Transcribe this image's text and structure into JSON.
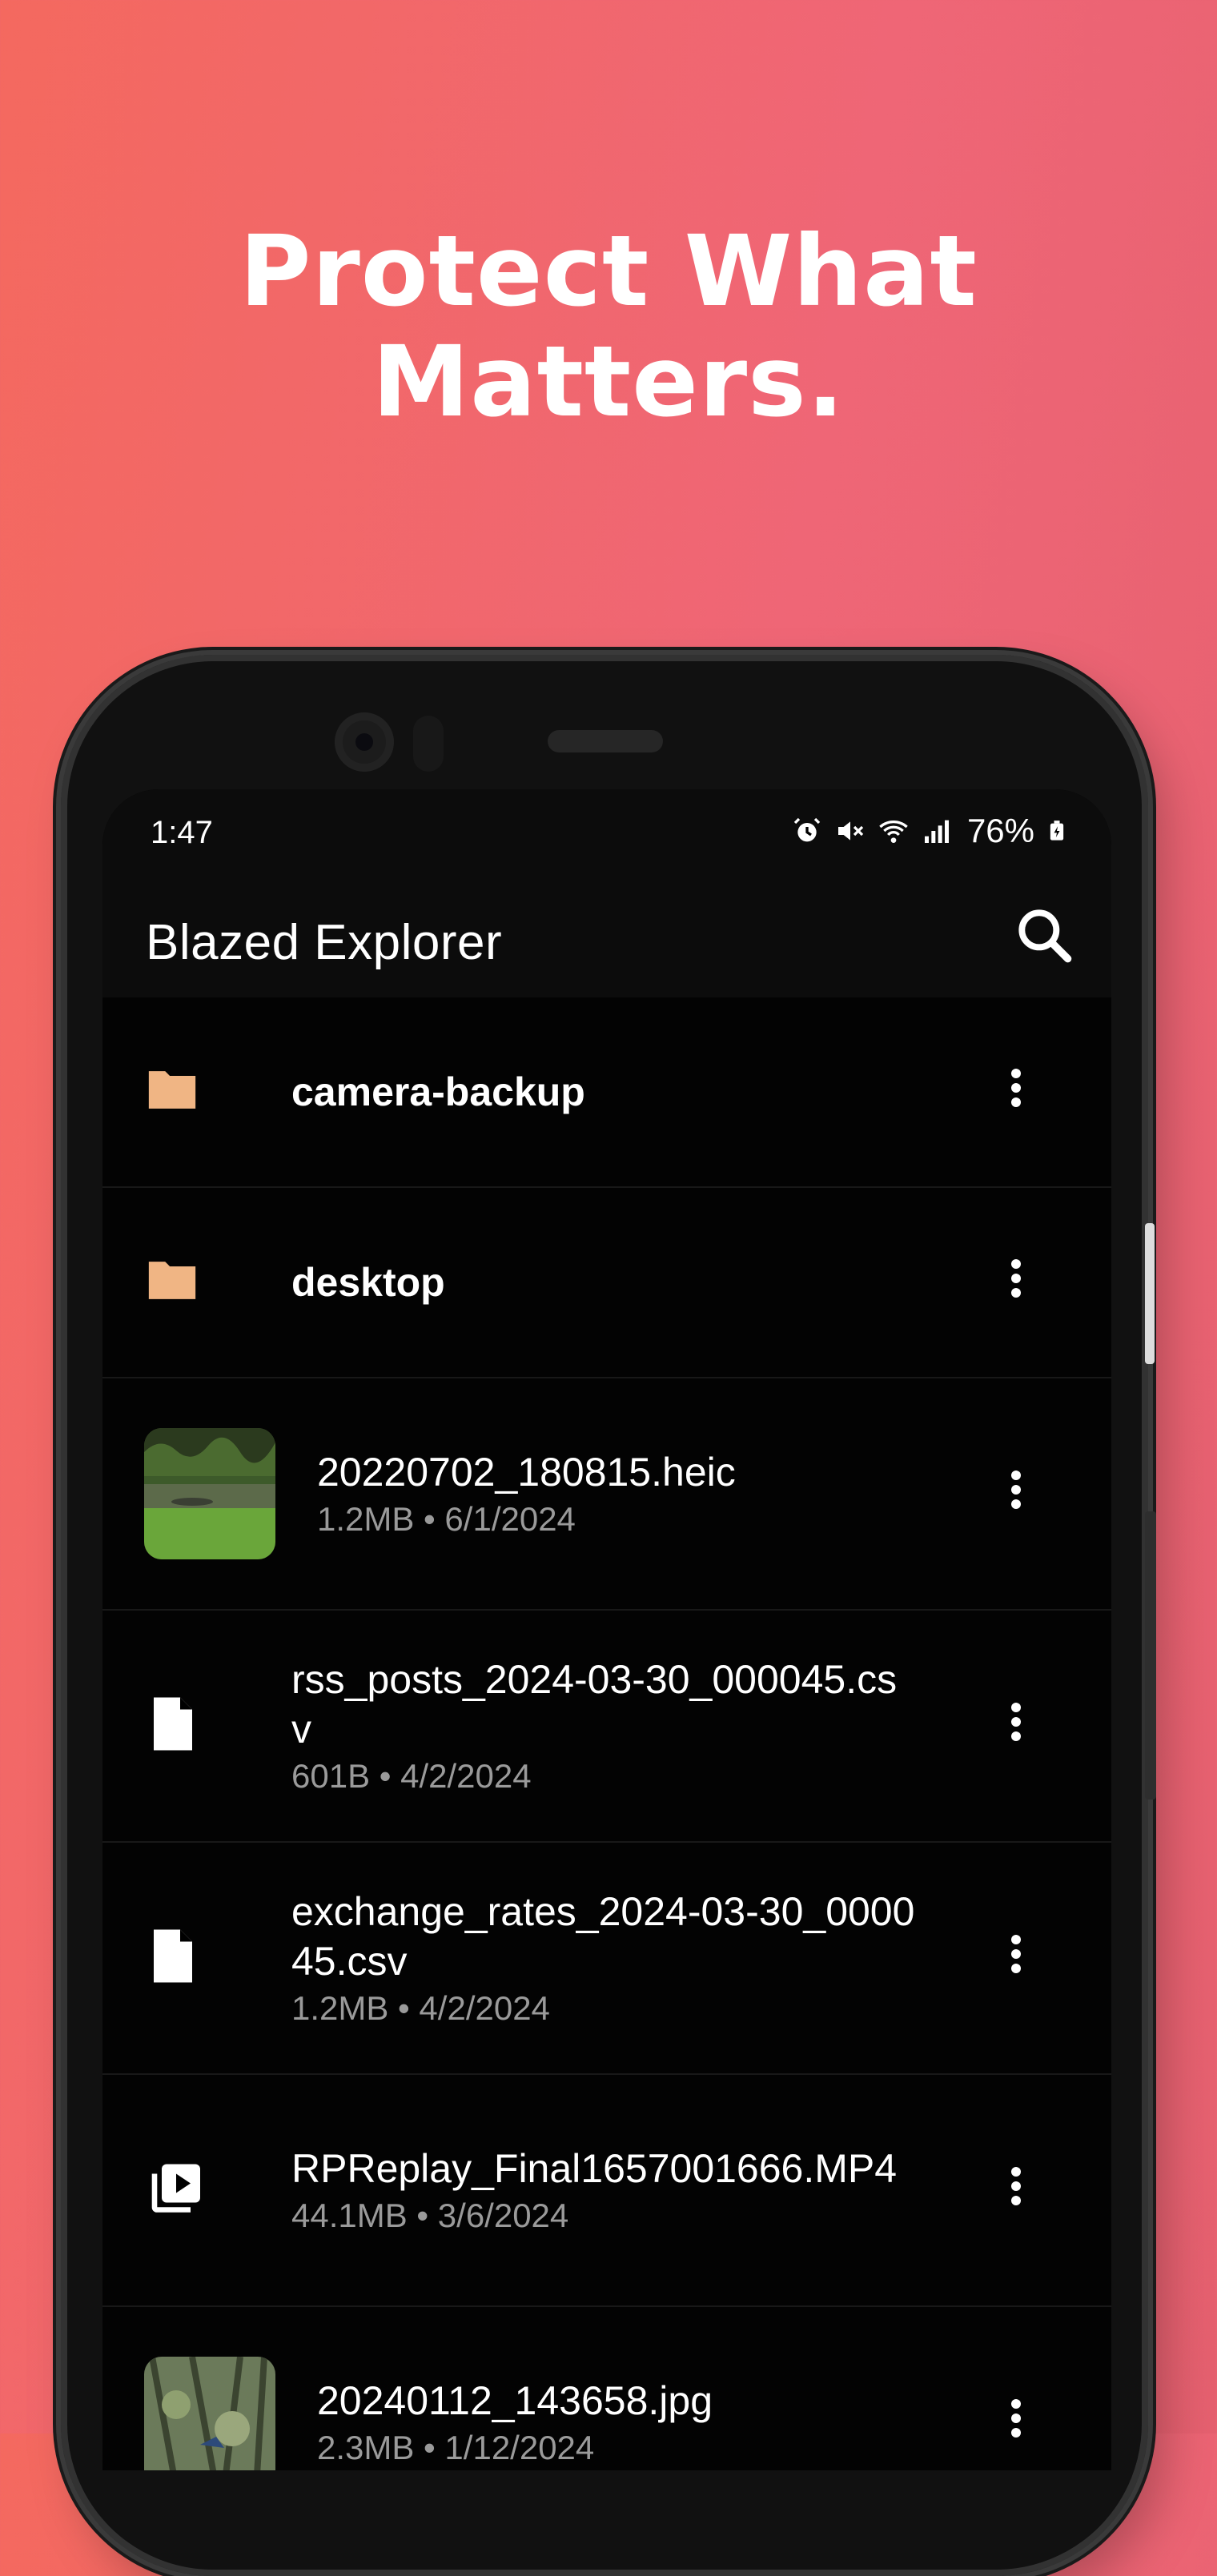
{
  "headline": {
    "line1": "Protect What",
    "line2": "Matters."
  },
  "status_bar": {
    "time": "1:47",
    "battery": "76%"
  },
  "app_bar": {
    "title": "Blazed Explorer"
  },
  "items": [
    {
      "type": "folder",
      "name": "camera-backup"
    },
    {
      "type": "folder",
      "name": "desktop"
    },
    {
      "type": "image",
      "name": "20220702_180815.heic",
      "meta": "1.2MB • 6/1/2024"
    },
    {
      "type": "file",
      "name": "rss_posts_2024-03-30_000045.csv",
      "meta": "601B • 4/2/2024"
    },
    {
      "type": "file",
      "name": "exchange_rates_2024-03-30_000045.csv",
      "meta": "1.2MB • 4/2/2024"
    },
    {
      "type": "video",
      "name": "RPReplay_Final1657001666.MP4",
      "meta": "44.1MB • 3/6/2024"
    },
    {
      "type": "image",
      "name": "20240112_143658.jpg",
      "meta": "2.3MB • 1/12/2024"
    }
  ],
  "colors": {
    "background_start": "#f4695f",
    "background_end": "#e5606f",
    "folder_icon": "#f0b584",
    "secondary_text": "#9a9a9a"
  },
  "icons": {
    "folder": "folder-icon",
    "file": "document-icon",
    "video": "video-library-icon",
    "more": "more-vertical-icon",
    "search": "search-icon"
  }
}
